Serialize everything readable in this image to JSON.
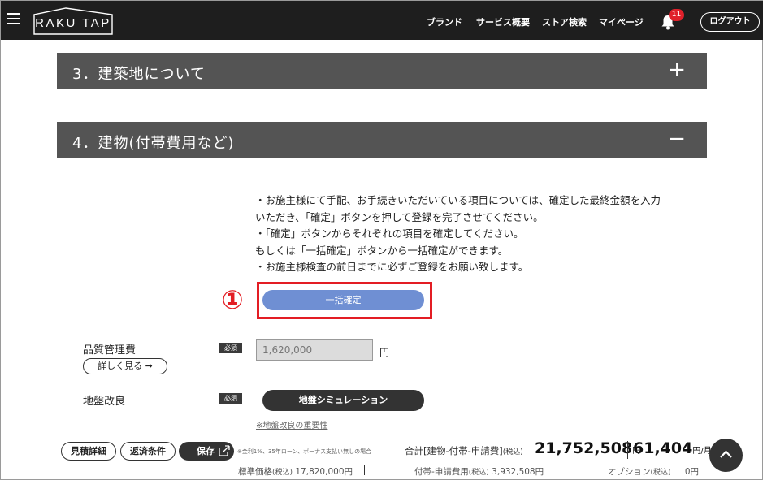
{
  "header": {
    "logo": "RAKU TAP",
    "nav": [
      "ブランド",
      "サービス概要",
      "ストア検索",
      "マイページ"
    ],
    "notification_count": "11",
    "logout_label": "ログアウト"
  },
  "sections": [
    {
      "title": "3．建築地について",
      "toggle": "+"
    },
    {
      "title": "4．建物(付帯費用など)",
      "toggle": "−"
    }
  ],
  "notes": [
    "・お施主様にて手配、お手続きいただいている項目については、確定した最終金額を入力",
    "いただき、「確定」ボタンを押して登録を完了させてください。",
    "・「確定」ボタンからそれぞれの項目を確定してください。",
    "もしくは「一括確定」ボタンから一括確定ができます。",
    "・お施主様検査の前日までに必ずご登録をお願い致します。"
  ],
  "annotation_number": "①",
  "bulk_confirm_label": "一括確定",
  "quality": {
    "label": "品質管理費",
    "required": "必須",
    "detail_label": "詳しく見る ➞",
    "input_value": "1,620,000",
    "unit": "円"
  },
  "ground": {
    "label": "地盤改良",
    "required": "必須",
    "sim_label": "地盤シミュレーション",
    "link_label": "※地盤改良の重要性"
  },
  "footer": {
    "estimate_detail": "見積詳細",
    "refund_terms": "返済条件",
    "save": "保存",
    "note": "※金利1%、35年ローン、ボーナス支払い無しの場合",
    "total_label": "合計[建物-付帯-申請費]",
    "tax_in": "(税込)",
    "total_amount": "21,752,508",
    "yen": "円",
    "monthly_amount": "61,404",
    "per_month": "円/月",
    "standard_label": "標準価格",
    "standard_value": "17,820,000円",
    "extra_label": "付帯-申請費用",
    "extra_value": "3,932,508円",
    "option_label": "オプション",
    "option_value": "0円"
  }
}
